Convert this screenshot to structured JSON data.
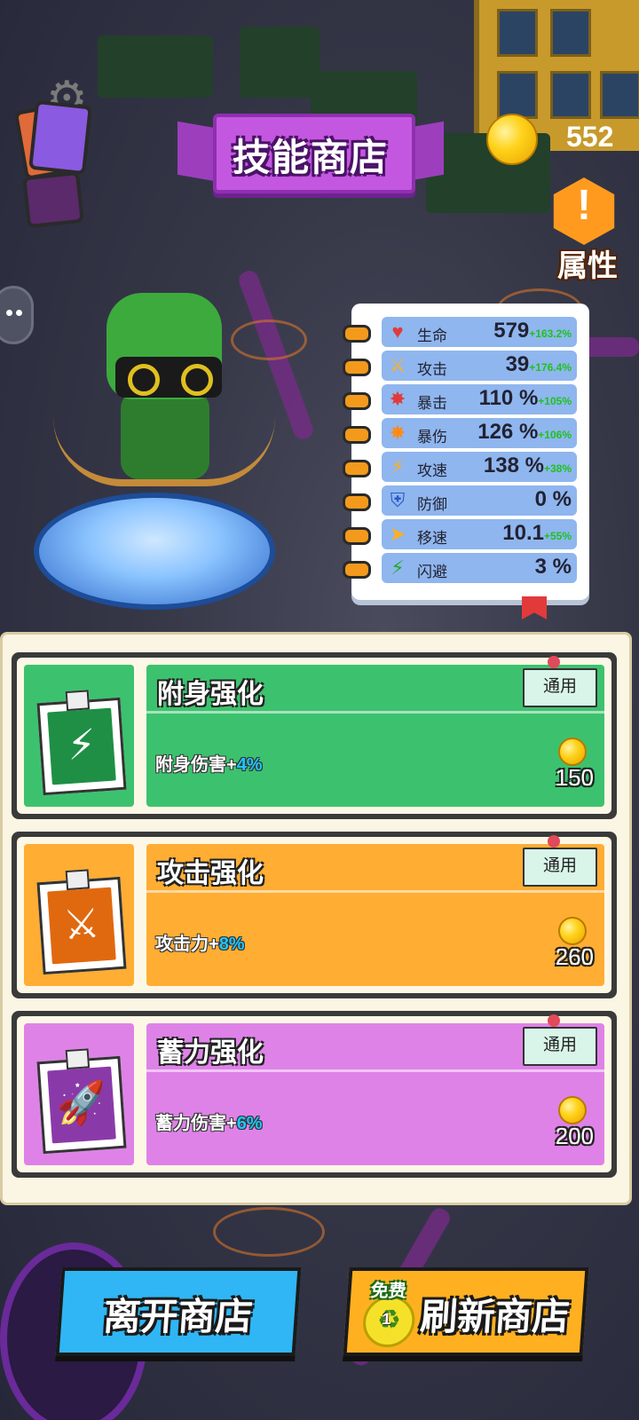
{
  "header": {
    "title": "技能商店",
    "coins": "552",
    "attribute_label": "属性",
    "attribute_icon": "exclamation-icon",
    "cards_icon": "cards-icon",
    "settings_icon": "gear-icon"
  },
  "stats": [
    {
      "icon": "heart-icon",
      "glyph": "♥",
      "color": "#e23a3a",
      "name": "生命",
      "value": "579",
      "bonus": "+163.2%"
    },
    {
      "icon": "sword-icon",
      "glyph": "⚔",
      "color": "#ffb020",
      "name": "攻击",
      "value": "39",
      "bonus": "+176.4%"
    },
    {
      "icon": "crit-icon",
      "glyph": "✸",
      "color": "#e23a3a",
      "name": "暴击",
      "value": "110 %",
      "bonus": "+105%"
    },
    {
      "icon": "crit-damage-icon",
      "glyph": "✸",
      "color": "#ff8a1a",
      "name": "暴伤",
      "value": "126 %",
      "bonus": "+106%"
    },
    {
      "icon": "attack-speed-icon",
      "glyph": "⚡",
      "color": "#ffb020",
      "name": "攻速",
      "value": "138 %",
      "bonus": "+38%"
    },
    {
      "icon": "shield-icon",
      "glyph": "⛨",
      "color": "#2a5ac8",
      "name": "防御",
      "value": "0 %",
      "bonus": ""
    },
    {
      "icon": "boot-icon",
      "glyph": "➤",
      "color": "#ffb020",
      "name": "移速",
      "value": "10.1",
      "bonus": "+55%"
    },
    {
      "icon": "dodge-icon",
      "glyph": "⚡",
      "color": "#2aa82a",
      "name": "闪避",
      "value": "3 %",
      "bonus": ""
    }
  ],
  "shop_items": [
    {
      "name": "附身强化",
      "tag": "通用",
      "desc_prefix": "附身伤害+",
      "desc_value": "4%",
      "price": "150",
      "icon": "lightning-orb-icon",
      "glyph": "⚡",
      "color": "#3cc26e",
      "dark": "#1f8f45"
    },
    {
      "name": "攻击强化",
      "tag": "通用",
      "desc_prefix": "攻击力+",
      "desc_value": "8%",
      "price": "260",
      "icon": "sword-icon",
      "glyph": "⚔",
      "color": "#ffad33",
      "dark": "#e0690f"
    },
    {
      "name": "蓄力强化",
      "tag": "通用",
      "desc_prefix": "蓄力伤害+",
      "desc_value": "6%",
      "price": "200",
      "icon": "rockets-icon",
      "glyph": "🚀",
      "color": "#de82e8",
      "dark": "#8a3aa8"
    }
  ],
  "buttons": {
    "leave": "离开商店",
    "refresh": "刷新商店",
    "free_label": "免费",
    "free_count": "1"
  }
}
